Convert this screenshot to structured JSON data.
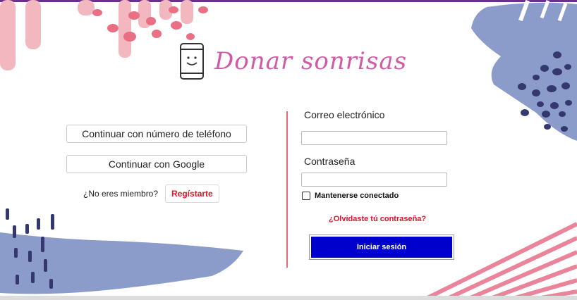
{
  "brand": {
    "title": "Donar sonrisas"
  },
  "left": {
    "phone_button": "Continuar con número de teléfono",
    "google_button": "Continuar con Google",
    "member_prompt": "¿No eres miembro?",
    "register_button": "Regístarte"
  },
  "login": {
    "email_label": "Correo electrónico",
    "email_value": "",
    "password_label": "Contraseña",
    "password_value": "",
    "keep_logged_in": "Mantenerse conectado",
    "keep_checked": false,
    "forgot_link": "¿Olvidaste tú contraseña?",
    "submit_button": "Iniciar sesión"
  },
  "colors": {
    "accent_pink": "#cf5aa5",
    "link_red": "#e0122a",
    "primary_blue": "#0000cc",
    "decor_blue": "#8b9ccb",
    "decor_navy": "#3a3a70",
    "decor_pink": "#f4a7b0"
  }
}
